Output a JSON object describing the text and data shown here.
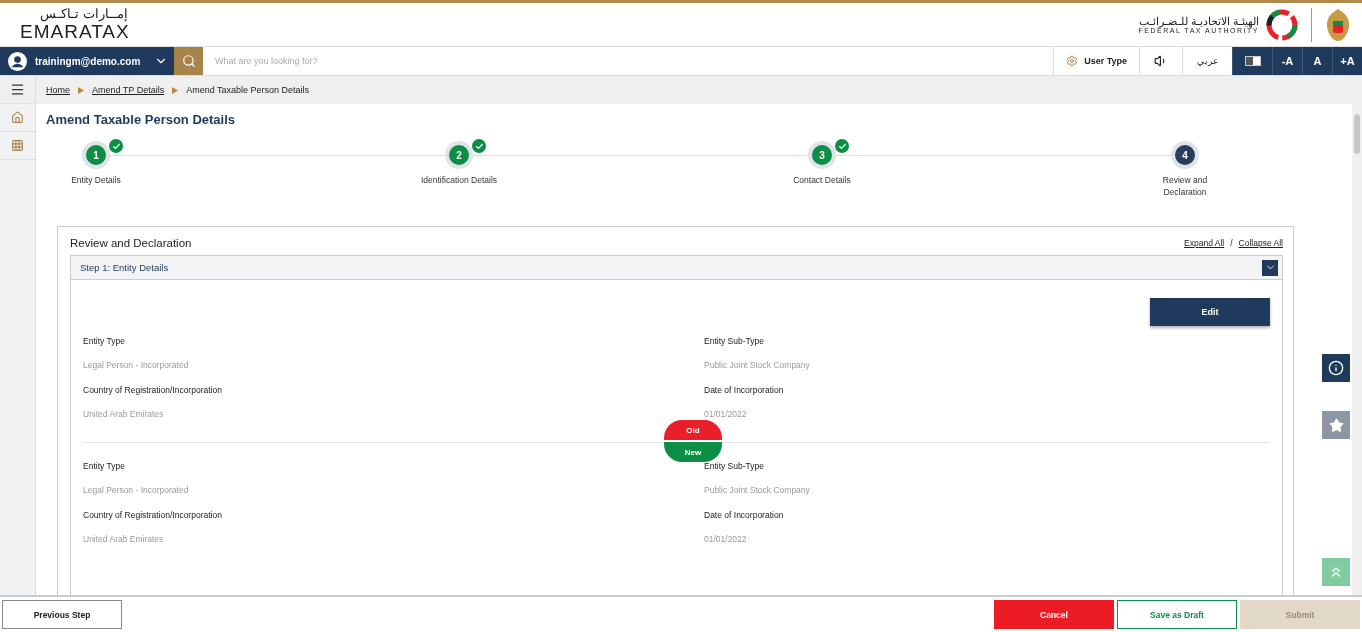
{
  "header": {
    "logo_arabic": "إمــارات تـاكـس",
    "logo_text": "EMARATAX",
    "authority_arabic": "الهيئـة الاتحاديـة للـضـرائـب",
    "authority_english": "FEDERAL TAX AUTHORITY"
  },
  "navbar": {
    "user": "trainingm@demo.com",
    "search_placeholder": "What are you looking for?",
    "user_type": "User Type",
    "language": "عربي",
    "font_buttons": [
      "-A",
      "A",
      "+A"
    ]
  },
  "breadcrumb": [
    {
      "label": "Home",
      "link": true
    },
    {
      "label": "Amend TP Details",
      "link": true
    },
    {
      "label": "Amend Taxable Person Details",
      "link": false
    }
  ],
  "page_title": "Amend Taxable Person Details",
  "steps": [
    {
      "number": "1",
      "label": "Entity Details",
      "completed": true,
      "current": false
    },
    {
      "number": "2",
      "label": "Identification Details",
      "completed": true,
      "current": false
    },
    {
      "number": "3",
      "label": "Contact Details",
      "completed": true,
      "current": false
    },
    {
      "number": "4",
      "label": "Review and Declaration",
      "completed": false,
      "current": true
    }
  ],
  "review": {
    "title": "Review and Declaration",
    "expand_all": "Expand All",
    "separator": "/",
    "collapse_all": "Collapse All",
    "section": {
      "title": "Step 1: Entity Details",
      "expanded": true,
      "edit": "Edit",
      "old_badge": "Old",
      "new_badge": "New",
      "old_fields": [
        {
          "label": "Entity Type",
          "value": "Legal Person - Incorporated"
        },
        {
          "label": "Entity Sub-Type",
          "value": "Public Joint Stock Company"
        },
        {
          "label": "Country of Registration/Incorporation",
          "value": "United Arab Emirates"
        },
        {
          "label": "Date of Incorporation",
          "value": "01/01/2022"
        }
      ],
      "new_fields": [
        {
          "label": "Entity Type",
          "value": "Legal Person - Incorporated"
        },
        {
          "label": "Entity Sub-Type",
          "value": "Public Joint Stock Company"
        },
        {
          "label": "Country of Registration/Incorporation",
          "value": "United Arab Emirates"
        },
        {
          "label": "Date of Incorporation",
          "value": "01/01/2022"
        }
      ]
    }
  },
  "footer": {
    "previous": "Previous Step",
    "cancel": "Cancel",
    "save_draft": "Save as Draft",
    "submit": {
      "label": "Submit",
      "disabled": true
    }
  }
}
